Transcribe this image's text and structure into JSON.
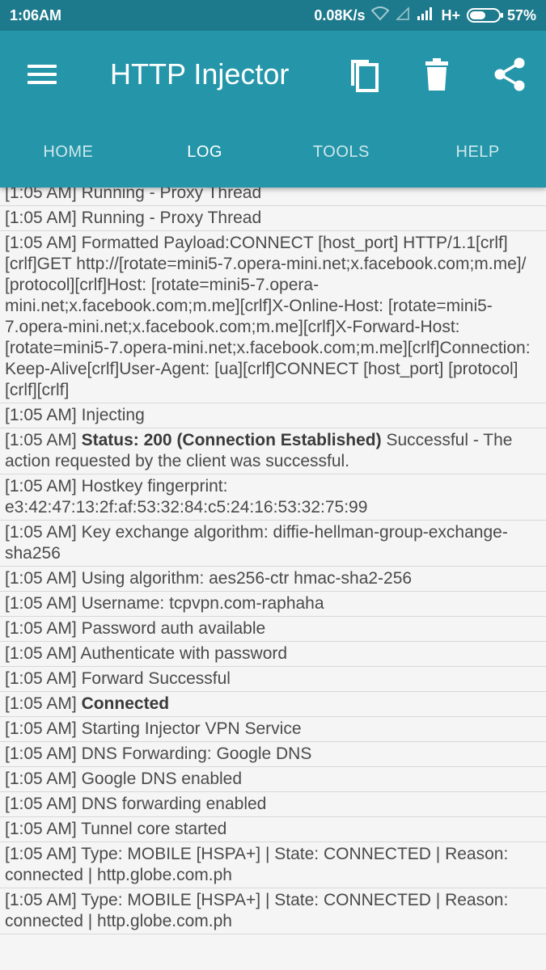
{
  "status_bar": {
    "time": "1:06AM",
    "speed": "0.08K/s",
    "network": "H+",
    "battery_percent": "57%",
    "battery_level": 0.57
  },
  "app_bar": {
    "title": "HTTP Injector",
    "icons": [
      "menu-icon",
      "copy-icon",
      "delete-icon",
      "share-icon"
    ],
    "accent_color": "#2596a9"
  },
  "tabs": [
    {
      "label": "HOME",
      "active": false
    },
    {
      "label": "LOG",
      "active": true
    },
    {
      "label": "TOOLS",
      "active": false
    },
    {
      "label": "HELP",
      "active": false
    }
  ],
  "log": [
    {
      "time": "[1:05 AM]",
      "text": "Running - Proxy Thread"
    },
    {
      "time": "[1:05 AM]",
      "text": "Running - Proxy Thread"
    },
    {
      "time": "[1:05 AM]",
      "text": "Formatted Payload:CONNECT [host_port] HTTP/1.1[crlf][crlf]GET http://[rotate=mini5-7.opera-mini.net;x.facebook.com;m.me]/ [protocol][crlf]Host: [rotate=mini5-7.opera-mini.net;x.facebook.com;m.me][crlf]X-Online-Host: [rotate=mini5-7.opera-mini.net;x.facebook.com;m.me][crlf]X-Forward-Host: [rotate=mini5-7.opera-mini.net;x.facebook.com;m.me][crlf]Connection: Keep-Alive[crlf]User-Agent: [ua][crlf]CONNECT [host_port] [protocol][crlf][crlf]"
    },
    {
      "time": "[1:05 AM]",
      "text": "Injecting"
    },
    {
      "time": "[1:05 AM]",
      "bold": "Status: 200 (Connection Established)",
      "text": "Successful - The action requested by the client was successful."
    },
    {
      "time": "[1:05 AM]",
      "text": "Hostkey fingerprint: e3:42:47:13:2f:af:53:32:84:c5:24:16:53:32:75:99"
    },
    {
      "time": "[1:05 AM]",
      "text": "Key exchange algorithm: diffie-hellman-group-exchange-sha256"
    },
    {
      "time": "[1:05 AM]",
      "text": "Using algorithm: aes256-ctr hmac-sha2-256"
    },
    {
      "time": "[1:05 AM]",
      "text": "Username: tcpvpn.com-raphaha"
    },
    {
      "time": "[1:05 AM]",
      "text": "Password auth available"
    },
    {
      "time": "[1:05 AM]",
      "text": "Authenticate with password"
    },
    {
      "time": "[1:05 AM]",
      "text": "Forward Successful"
    },
    {
      "time": "[1:05 AM]",
      "bold": "Connected",
      "text": ""
    },
    {
      "time": "[1:05 AM]",
      "text": "Starting Injector VPN Service"
    },
    {
      "time": "[1:05 AM]",
      "text": "DNS Forwarding: Google DNS"
    },
    {
      "time": "[1:05 AM]",
      "text": "Google DNS enabled"
    },
    {
      "time": "[1:05 AM]",
      "text": "DNS forwarding enabled"
    },
    {
      "time": "[1:05 AM]",
      "text": "Tunnel core started"
    },
    {
      "time": "[1:05 AM]",
      "text": "Type: MOBILE [HSPA+] | State: CONNECTED | Reason: connected | http.globe.com.ph"
    },
    {
      "time": "[1:05 AM]",
      "text": "Type: MOBILE [HSPA+] | State: CONNECTED | Reason: connected | http.globe.com.ph"
    }
  ]
}
